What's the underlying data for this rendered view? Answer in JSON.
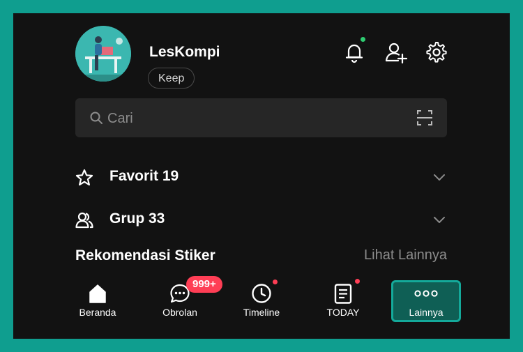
{
  "profile": {
    "name": "LesKompi",
    "keep_label": "Keep"
  },
  "header_icons": [
    "bell-icon",
    "add-friend-icon",
    "gear-icon"
  ],
  "search": {
    "placeholder": "Cari"
  },
  "lists": {
    "favorites_label": "Favorit 19",
    "groups_label": "Grup 33"
  },
  "stickers": {
    "title": "Rekomendasi Stiker",
    "see_more": "Lihat Lainnya"
  },
  "bottom_nav": {
    "home": "Beranda",
    "chats": "Obrolan",
    "chats_badge": "999+",
    "timeline": "Timeline",
    "today": "TODAY",
    "more": "Lainnya"
  },
  "colors": {
    "background": "#121212",
    "accent": "#14a99a",
    "notification_red": "#ff3e55",
    "online_green": "#2ecc71"
  }
}
